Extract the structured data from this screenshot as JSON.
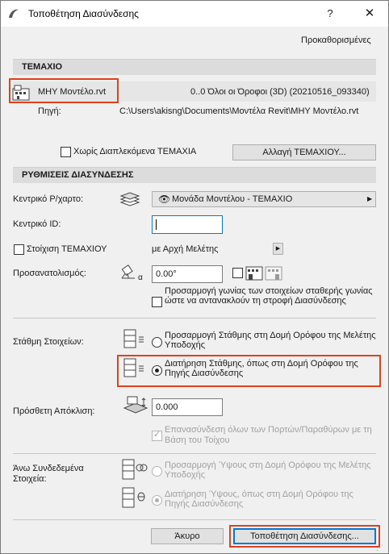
{
  "window": {
    "title": "Τοποθέτηση Διασύνδεσης",
    "help": "?",
    "close": "✕"
  },
  "presets_link": "Προκαθορισμένες",
  "part_section": {
    "header": "ΤΕΜΑΧΙΟ",
    "file_name": "ΜΗΥ Μοντέλο.rvt",
    "story_info": "0..0 Όλοι οι Όροφοι (3D) (20210516_093340)",
    "source_label": "Πηγή:",
    "source_path": "C:\\Users\\akisng\\Documents\\Μοντέλα Revit\\ΜΗΥ Μοντέλο.rvt",
    "no_nested_label": "Χωρίς Διαπλεκόμενα ΤΕΜΑΧΙΑ",
    "change_button": "Αλλαγή ΤΕΜΑΧΙΟΥ..."
  },
  "link_settings": {
    "header": "ΡΥΘΜΙΣΕΙΣ ΔΙΑΣΥΝΔΕΣΗΣ",
    "master_layout_label": "Κεντρικό Ρ/χαρτο:",
    "master_layout_value": "Μονάδα Μοντέλου - ΤΕΜΑΧΙΟ",
    "master_id_label": "Κεντρικό ID:",
    "master_id_value": "",
    "align_label": "Στοίχιση ΤΕΜΑΧΙΟΥ",
    "align_value": "με Αρχή Μελέτης",
    "orientation_label": "Προσανατολισμός:",
    "orientation_value": "0.00°",
    "orientation_symbol": "α",
    "adjust_angle_label": "Προσαρμογή γωνίας των στοιχείων σταθερής γωνίας ώστε να αντανακλούν τη στροφή Διασύνδεσης"
  },
  "elevation": {
    "label": "Στάθμη Στοιχείων:",
    "option1": "Προσαρμογή Στάθμης στη Δομή Ορόφου της Μελέτης Υποδοχής",
    "option2": "Διατήρηση Στάθμης, όπως στη Δομή Ορόφου της Πηγής Διασύνδεσης",
    "selected": 2
  },
  "offset": {
    "label": "Πρόσθετη Απόκλιση:",
    "value": "0.000"
  },
  "relink_label": "Επανασύνδεση όλων των Πορτών/Παραθύρων με τη Βάση του Τοίχου",
  "top_linked": {
    "label": "Άνω Συνδεδεμένα Στοιχεία:",
    "option1": "Προσαρμογή Ύψους στη Δομή Ορόφου της Μελέτης Υποδοχής",
    "option2": "Διατήρηση Ύψους, όπως στη Δομή Ορόφου της Πηγής Διασύνδεσης",
    "selected": 2
  },
  "footer": {
    "cancel": "Άκυρο",
    "place": "Τοποθέτηση Διασύνδεσης..."
  },
  "colors": {
    "highlight": "#e0401c",
    "accent": "#0078d7"
  }
}
